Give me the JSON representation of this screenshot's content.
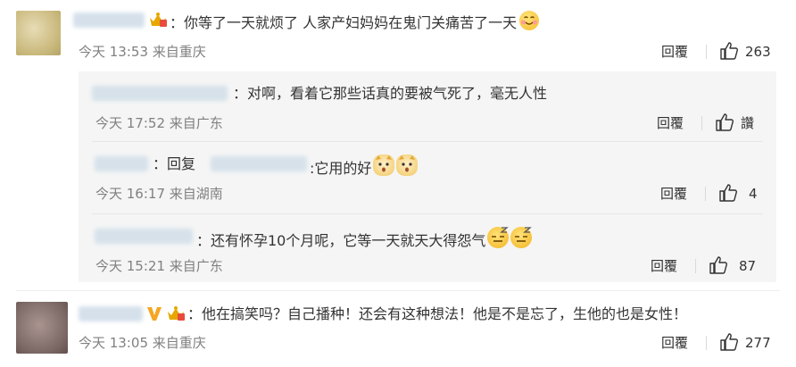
{
  "comments": [
    {
      "text": "：你等了一天就烦了 人家产妇妈妈在鬼门关痛苦了一天",
      "time": "今天 13:53",
      "source": "来自重庆",
      "reply_label": "回覆",
      "likes": "263"
    },
    {
      "text": "：他在搞笑吗？自己播种！还会有这种想法！他是不是忘了，生他的也是女性！",
      "time": "今天 13:05",
      "source": "来自重庆",
      "reply_label": "回覆",
      "likes": "277"
    }
  ],
  "replies": [
    {
      "text": "：对啊，看着它那些话真的要被气死了，毫无人性",
      "time": "今天 17:52",
      "source": "来自广东",
      "reply_label": "回覆",
      "likes": "讚"
    },
    {
      "prefix": "：回复",
      "text": ":它用的好",
      "time": "今天 16:17",
      "source": "来自湖南",
      "reply_label": "回覆",
      "likes": "4"
    },
    {
      "text": "：还有怀孕10个月呢，它等一天就天大得怨气",
      "time": "今天 15:21",
      "source": "来自广东",
      "reply_label": "回覆",
      "likes": "87"
    }
  ],
  "icons": {
    "like": "thumbs-up-icon",
    "crown": "crown-badge-icon",
    "verified": "verified-v-icon",
    "emoji_smile": "smile-emoji-icon",
    "emoji_cat": "cat-emoji-icon",
    "emoji_sleepy": "sleepy-emoji-icon"
  },
  "colors": {
    "meta_text": "#808080",
    "reply_bg": "#f5f5f5",
    "verified": "#f5a623",
    "crown": "#e0a100"
  }
}
